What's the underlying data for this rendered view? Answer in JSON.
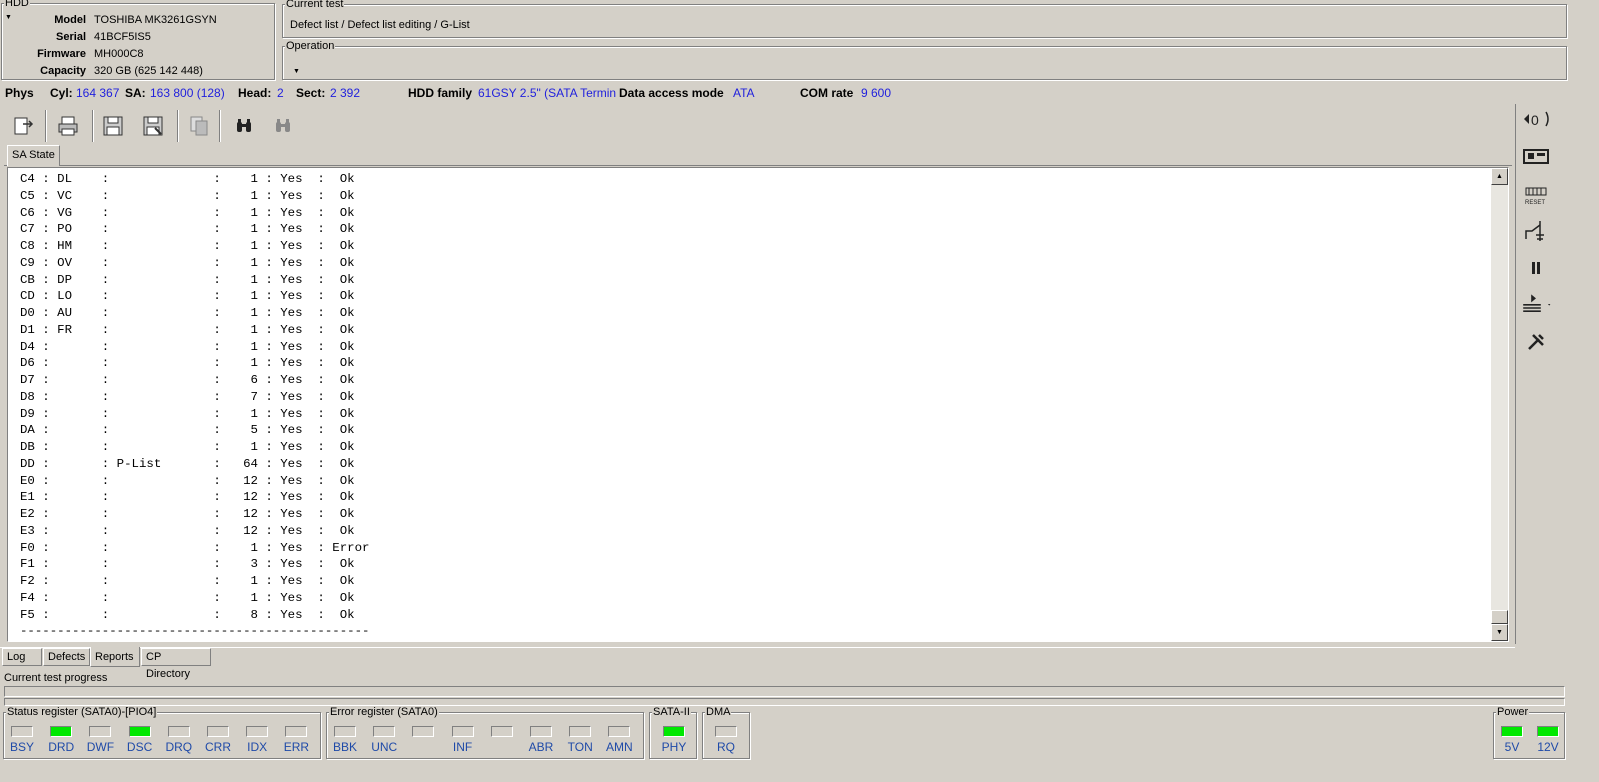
{
  "hdd": {
    "title": "HDD",
    "rows": [
      {
        "label": "Model",
        "value": "TOSHIBA MK3261GSYN"
      },
      {
        "label": "Serial",
        "value": "41BCF5IS5"
      },
      {
        "label": "Firmware",
        "value": "MH000C8"
      },
      {
        "label": "Capacity",
        "value": "320 GB (625 142 448)"
      }
    ]
  },
  "current_test": {
    "title": "Current test",
    "value": "Defect list / Defect list editing / G-List"
  },
  "operation": {
    "title": "Operation",
    "value": ""
  },
  "status_line": {
    "phys": "Phys",
    "cyl_label": "Cyl:",
    "cyl_value": "164 367",
    "sa_label": "SA:",
    "sa_value": "163 800 (128)",
    "head_label": "Head:",
    "head_value": "2",
    "sect_label": "Sect:",
    "sect_value": "2 392",
    "family_label": "HDD family",
    "family_value": "61GSY 2.5\" (SATA Termin",
    "access_label": "Data access mode",
    "access_value": "ATA",
    "com_label": "COM rate",
    "com_value": "9 600"
  },
  "toolbar": {
    "icons": [
      "export-icon",
      "print-icon",
      "save-icon",
      "save-as-icon",
      "copy-icon",
      "find-icon",
      "find-next-icon"
    ]
  },
  "report_tab": "SA State",
  "report_lines": [
    "C4 : DL    :              :    1 : Yes  :  Ok",
    "C5 : VC    :              :    1 : Yes  :  Ok",
    "C6 : VG    :              :    1 : Yes  :  Ok",
    "C7 : PO    :              :    1 : Yes  :  Ok",
    "C8 : HM    :              :    1 : Yes  :  Ok",
    "C9 : OV    :              :    1 : Yes  :  Ok",
    "CB : DP    :              :    1 : Yes  :  Ok",
    "CD : LO    :              :    1 : Yes  :  Ok",
    "D0 : AU    :              :    1 : Yes  :  Ok",
    "D1 : FR    :              :    1 : Yes  :  Ok",
    "D4 :       :              :    1 : Yes  :  Ok",
    "D6 :       :              :    1 : Yes  :  Ok",
    "D7 :       :              :    6 : Yes  :  Ok",
    "D8 :       :              :    7 : Yes  :  Ok",
    "D9 :       :              :    1 : Yes  :  Ok",
    "DA :       :              :    5 : Yes  :  Ok",
    "DB :       :              :    1 : Yes  :  Ok",
    "DD :       : P-List       :   64 : Yes  :  Ok",
    "E0 :       :              :   12 : Yes  :  Ok",
    "E1 :       :              :   12 : Yes  :  Ok",
    "E2 :       :              :   12 : Yes  :  Ok",
    "E3 :       :              :   12 : Yes  :  Ok",
    "F0 :       :              :    1 : Yes  : Error",
    "F1 :       :              :    3 : Yes  :  Ok",
    "F2 :       :              :    1 : Yes  :  Ok",
    "F4 :       :              :    1 : Yes  :  Ok",
    "F5 :       :              :    8 : Yes  :  Ok",
    "-----------------------------------------------"
  ],
  "bottom_tabs": [
    "Log",
    "Defects",
    "Reports",
    "CP Directory"
  ],
  "progress": {
    "label": "Current test progress",
    "fraction": 0
  },
  "status_register": {
    "title": "Status register (SATA0)-[PIO4]",
    "leds": [
      {
        "name": "BSY",
        "on": false
      },
      {
        "name": "DRD",
        "on": true
      },
      {
        "name": "DWF",
        "on": false
      },
      {
        "name": "DSC",
        "on": true
      },
      {
        "name": "DRQ",
        "on": false
      },
      {
        "name": "CRR",
        "on": false
      },
      {
        "name": "IDX",
        "on": false
      },
      {
        "name": "ERR",
        "on": false
      }
    ]
  },
  "error_register": {
    "title": "Error register (SATA0)",
    "leds": [
      {
        "name": "BBK",
        "on": false
      },
      {
        "name": "UNC",
        "on": false
      },
      {
        "name": "",
        "on": false
      },
      {
        "name": "INF",
        "on": false
      },
      {
        "name": "",
        "on": false
      },
      {
        "name": "ABR",
        "on": false
      },
      {
        "name": "TON",
        "on": false
      },
      {
        "name": "AMN",
        "on": false
      }
    ]
  },
  "sata2": {
    "title": "SATA-II",
    "leds": [
      {
        "name": "PHY",
        "on": true
      }
    ]
  },
  "dma": {
    "title": "DMA",
    "leds": [
      {
        "name": "RQ",
        "on": false
      }
    ]
  },
  "power": {
    "title": "Power",
    "leds": [
      {
        "name": "5V",
        "on": true
      },
      {
        "name": "12V",
        "on": true
      }
    ]
  },
  "colors": {
    "led_on": "#00e800",
    "value_blue": "#1f1fdd",
    "led_label": "#1f4aa8",
    "background": "#d4d0c8"
  }
}
